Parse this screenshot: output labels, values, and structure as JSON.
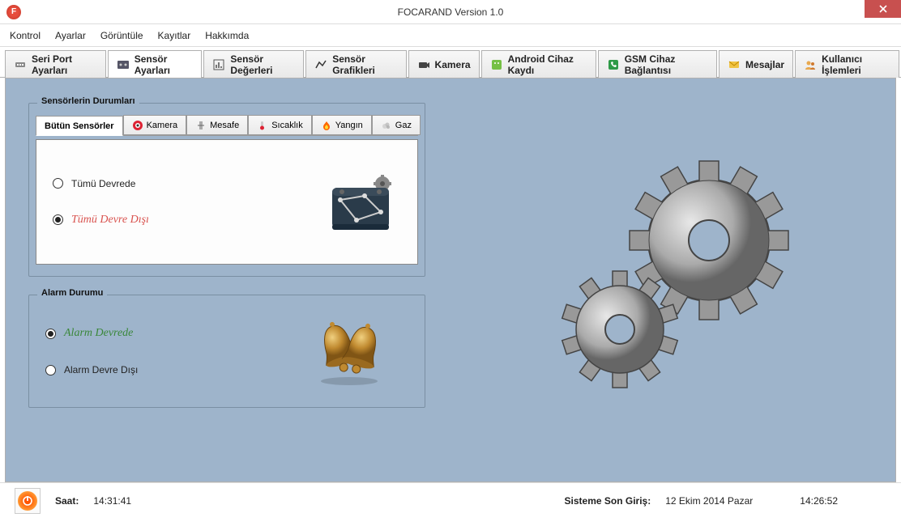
{
  "window": {
    "title": "FOCARAND Version 1.0",
    "icon_letter": "F"
  },
  "menu": {
    "items": [
      "Kontrol",
      "Ayarlar",
      "Görüntüle",
      "Kayıtlar",
      "Hakkımda"
    ]
  },
  "tabs": [
    {
      "label": "Seri Port Ayarları"
    },
    {
      "label": "Sensör Ayarları"
    },
    {
      "label": "Sensör Değerleri"
    },
    {
      "label": "Sensör Grafikleri"
    },
    {
      "label": "Kamera"
    },
    {
      "label": "Android Cihaz Kaydı"
    },
    {
      "label": "GSM Cihaz Bağlantısı"
    },
    {
      "label": "Mesajlar"
    },
    {
      "label": "Kullanıcı İşlemleri"
    }
  ],
  "sensor_group": {
    "title": "Sensörlerin Durumları",
    "subtabs": [
      "Bütün Sensörler",
      "Kamera",
      "Mesafe",
      "Sıcaklık",
      "Yangın",
      "Gaz"
    ],
    "radio_all_on": "Tümü Devrede",
    "radio_all_off": "Tümü Devre Dışı"
  },
  "alarm_group": {
    "title": "Alarm Durumu",
    "radio_on": "Alarm Devrede",
    "radio_off": "Alarm Devre Dışı"
  },
  "status": {
    "time_label": "Saat:",
    "time_value": "14:31:41",
    "login_label": "Sisteme Son Giriş:",
    "login_date": "12 Ekim 2014 Pazar",
    "login_time": "14:26:52"
  }
}
